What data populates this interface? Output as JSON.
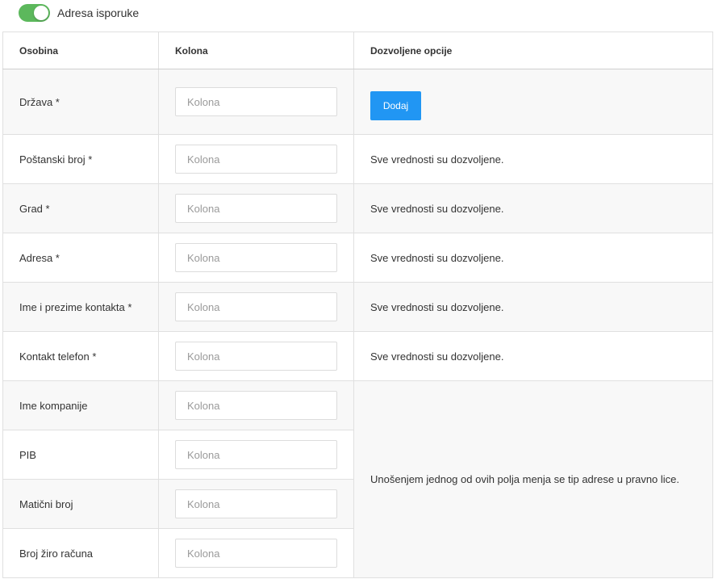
{
  "toggle": {
    "label": "Adresa isporuke",
    "enabled": true,
    "color": "#5cb85c"
  },
  "table": {
    "headers": {
      "property": "Osobina",
      "column": "Kolona",
      "options": "Dozvoljene opcije"
    },
    "input_placeholder": "Kolona",
    "add_button": "Dodaj",
    "allowed_text": "Sve vrednosti su dozvoljene.",
    "company_note": "Unošenjem jednog od ovih polja menja se tip adrese u pravno lice.",
    "rows": [
      {
        "label": "Država *"
      },
      {
        "label": "Poštanski broj *"
      },
      {
        "label": "Grad *"
      },
      {
        "label": "Adresa *"
      },
      {
        "label": "Ime i prezime kontakta *"
      },
      {
        "label": "Kontakt telefon *"
      },
      {
        "label": "Ime kompanije"
      },
      {
        "label": "PIB"
      },
      {
        "label": "Matični broj"
      },
      {
        "label": "Broj žiro računa"
      }
    ]
  },
  "colors": {
    "accent_button": "#2196f3",
    "row_alt": "#f8f8f8",
    "border": "#e0e0e0"
  }
}
